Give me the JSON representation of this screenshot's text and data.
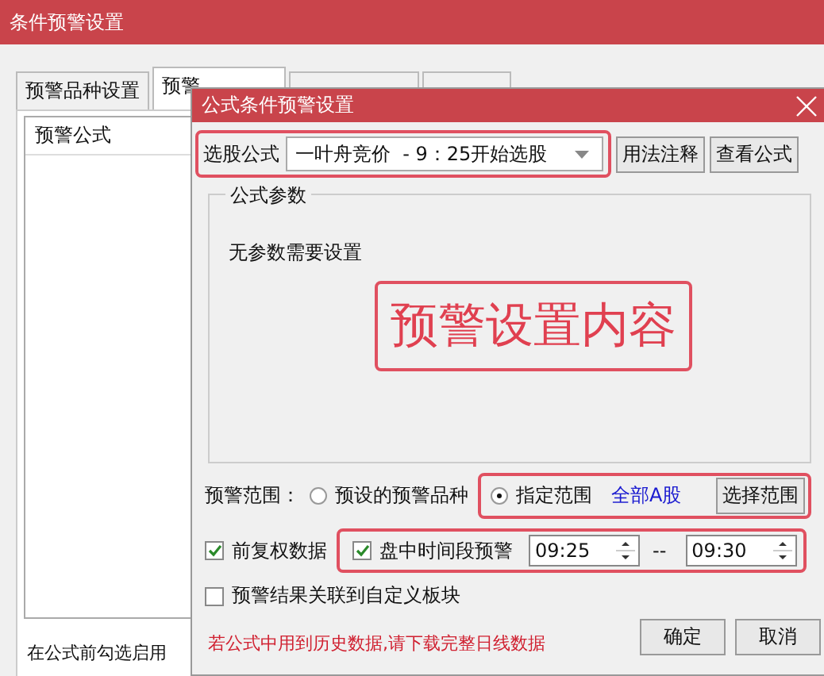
{
  "window": {
    "title": "条件预警设置"
  },
  "tabs": [
    {
      "label": "预警品种设置",
      "selected": false
    },
    {
      "label": "预警",
      "selected": true
    },
    {
      "selected": false
    },
    {
      "selected": false
    }
  ],
  "formula_list": {
    "header": "预警公式",
    "hint": "在公式前勾选启用"
  },
  "dialog": {
    "title": "公式条件预警设置",
    "formula_label": "选股公式",
    "formula_value": "一叶舟竞价  - 9：25开始选股",
    "top_buttons": [
      "用法注释",
      "查看公式"
    ],
    "params": {
      "title": "公式参数",
      "message": "无参数需要设置"
    },
    "callout": "预警设置内容",
    "range": {
      "label": "预警范围：",
      "options": [
        {
          "label": "预设的预警品种",
          "selected": false
        },
        {
          "label": "指定范围",
          "selected": true
        }
      ],
      "link": "全部A股",
      "button": "选择范围"
    },
    "adjusted": {
      "label": "前复权数据",
      "checked": true
    },
    "intraday": {
      "label": "盘中时间段预警",
      "checked": true,
      "start": "09:25",
      "separator": "--",
      "end": "09:30"
    },
    "link_block": {
      "label": "预警结果关联到自定义板块",
      "checked": false
    },
    "note": "若公式中用到历史数据,请下载完整日线数据",
    "footer_buttons": [
      "确定",
      "取消"
    ]
  }
}
